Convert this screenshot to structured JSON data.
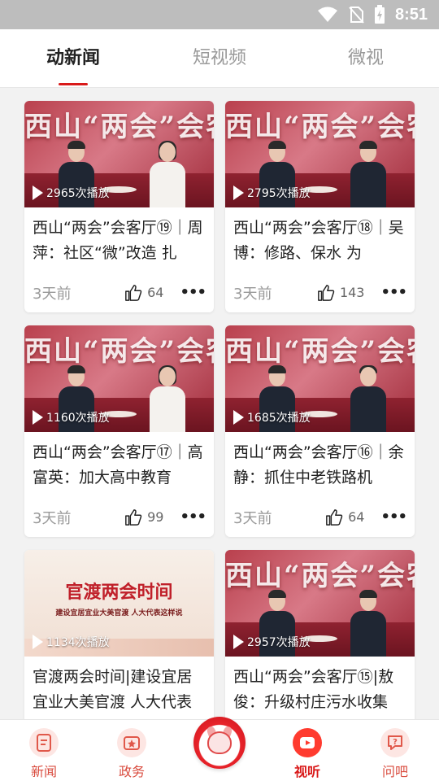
{
  "status_bar": {
    "time": "8:51",
    "icons": [
      "wifi-icon",
      "no-sim-icon",
      "battery-charging-icon"
    ]
  },
  "tabs": [
    {
      "label": "动新闻",
      "active": true
    },
    {
      "label": "短视频",
      "active": false
    },
    {
      "label": "微视",
      "active": false
    }
  ],
  "cards": [
    {
      "title": "西山“两会”会客厅⑲｜周萍：社区“微”改造 扎",
      "plays": "2965次播放",
      "date": "3天前",
      "likes": "64",
      "thumb": "studio"
    },
    {
      "title": "西山“两会”会客厅⑱｜吴博：修路、保水 为",
      "plays": "2795次播放",
      "date": "3天前",
      "likes": "143",
      "thumb": "studio"
    },
    {
      "title": "西山“两会”会客厅⑰｜高富英：加大高中教育",
      "plays": "1160次播放",
      "date": "3天前",
      "likes": "99",
      "thumb": "studio"
    },
    {
      "title": "西山“两会”会客厅⑯｜余静：抓住中老铁路机",
      "plays": "1685次播放",
      "date": "3天前",
      "likes": "64",
      "thumb": "studio"
    },
    {
      "title": "官渡两会时间|建设宜居宜业大美官渡 人大代表",
      "plays": "1134次播放",
      "date": "",
      "likes": "",
      "thumb": "banner",
      "banner_title": "官渡两会时间",
      "banner_sub": "建设宜居宜业大美官渡  人大代表这样说"
    },
    {
      "title": "西山“两会”会客厅⑮|敖俊：升级村庄污水收集",
      "plays": "2957次播放",
      "date": "",
      "likes": "",
      "thumb": "studio"
    }
  ],
  "thumb_brand": "西山“两会”会客厅",
  "bottom_nav": [
    {
      "label": "新闻",
      "icon": "news-icon",
      "active": false
    },
    {
      "label": "政务",
      "icon": "government-icon",
      "active": false
    },
    {
      "label": "",
      "icon": "mascot-icon",
      "active": false
    },
    {
      "label": "视听",
      "icon": "video-play-icon",
      "active": true
    },
    {
      "label": "问吧",
      "icon": "question-chat-icon",
      "active": false
    }
  ],
  "colors": {
    "accent": "#d91a1a",
    "nav_label": "#d94b3e",
    "status_bar": "#bdbdbd"
  }
}
